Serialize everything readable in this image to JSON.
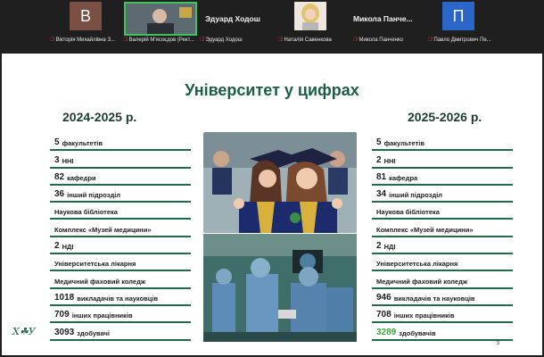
{
  "participants": [
    {
      "initial": "В",
      "name": "Вікторія Михайлівна З...",
      "tile_color": "#7b5044"
    },
    {
      "name": "Валерій М'ясоєдов (Рект...",
      "speaking": true
    },
    {
      "display_name": "Эдуард Ходош",
      "name": "Эдуард Ходош"
    },
    {
      "name": "Наталія Савенкова"
    },
    {
      "display_name": "Микола  Панче...",
      "name": "Микола Панченко"
    },
    {
      "initial": "П",
      "name": "Павло Дмитрович Пе...",
      "tile_color": "#2a66c9"
    }
  ],
  "slide": {
    "title": "Університет у цифрах",
    "page_number": "3",
    "logo_text": "Х☘У",
    "left": {
      "year": "2024-2025 р.",
      "rows": [
        {
          "num": "5",
          "text": "факультетів"
        },
        {
          "num": "3",
          "text": "ННІ"
        },
        {
          "num": "82",
          "text": "кафедри"
        },
        {
          "num": "36",
          "text": "інший підрозділ"
        },
        {
          "num": "",
          "text": "Наукова бібліотека"
        },
        {
          "num": "",
          "text": "Комплекс «Музей медицини»"
        },
        {
          "num": "2",
          "text": "НДІ"
        },
        {
          "num": "",
          "text": "Університетська лікарня"
        },
        {
          "num": "",
          "text": "Медичний фаховий коледж"
        },
        {
          "num": "1018",
          "text": "викладачів та науковців"
        },
        {
          "num": "709",
          "text": "інших працівників"
        },
        {
          "num": "3093",
          "text": "здобувачі"
        }
      ]
    },
    "right": {
      "year": "2025-2026 р.",
      "rows": [
        {
          "num": "5",
          "text": "факультетів"
        },
        {
          "num": "2",
          "text": "ННІ"
        },
        {
          "num": "81",
          "text": "кафедра"
        },
        {
          "num": "34",
          "text": "інший підрозділ"
        },
        {
          "num": "",
          "text": "Наукова бібліотека"
        },
        {
          "num": "",
          "text": "Комплекс «Музей медицини»"
        },
        {
          "num": "2",
          "text": "НДІ"
        },
        {
          "num": "",
          "text": "Університетська лікарня"
        },
        {
          "num": "",
          "text": "Медичний фаховий коледж"
        },
        {
          "num": "946",
          "text": "викладачів та науковців"
        },
        {
          "num": "708",
          "text": "інших працівників"
        },
        {
          "num": "3289",
          "text": "здобувачів",
          "highlight": true
        }
      ]
    }
  }
}
